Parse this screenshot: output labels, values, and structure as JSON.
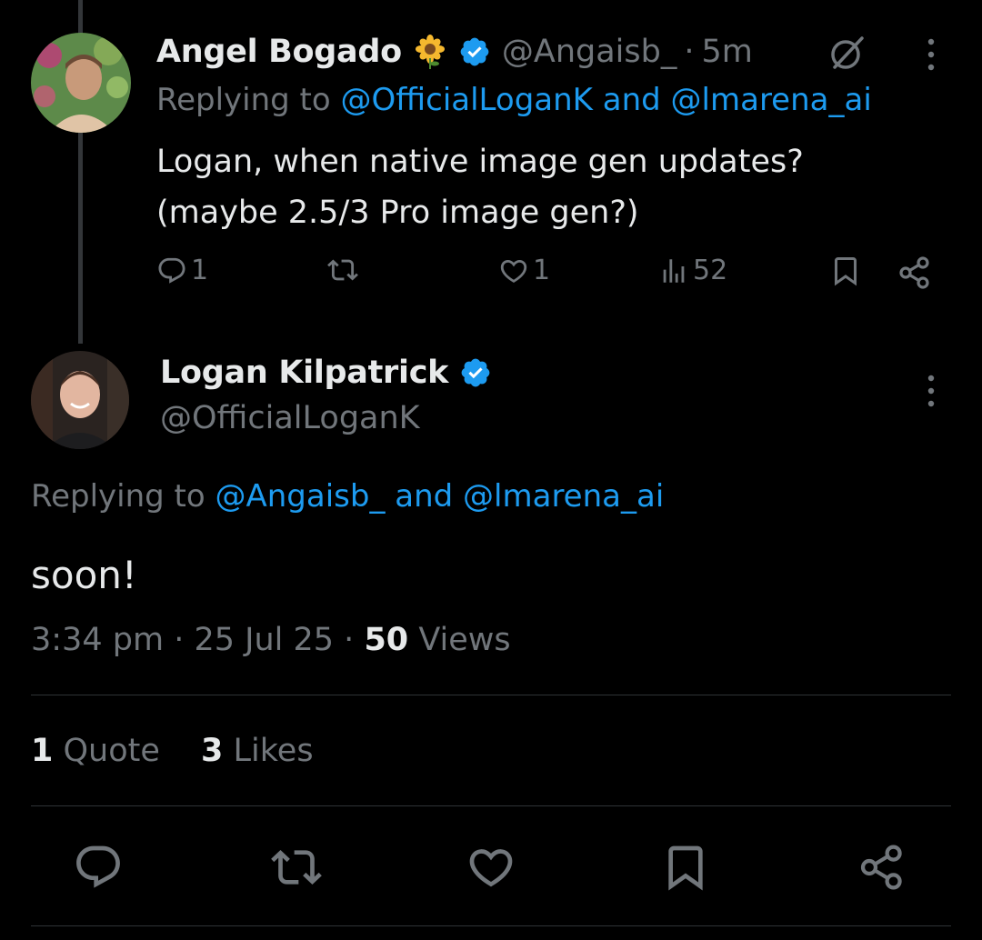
{
  "reply_tweet": {
    "display_name": "Angel Bogado",
    "emoji": "🌻",
    "handle": "@Angaisb_",
    "separator": "·",
    "time_ago": "5m",
    "replying_prefix": "Replying to ",
    "replying_users": "@OfficialLoganK and @lmarena_ai",
    "text_line1": "Logan, when native image gen updates?",
    "text_line2": "(maybe 2.5/3 Pro image gen?)",
    "actions": {
      "reply_count": "1",
      "repost_count": "",
      "like_count": "1",
      "views_count": "52"
    }
  },
  "main_tweet": {
    "display_name": "Logan Kilpatrick",
    "handle": "@OfficialLoganK",
    "replying_prefix": "Replying to ",
    "replying_users": "@Angaisb_ and @lmarena_ai",
    "text": "soon!",
    "time": "3:34 pm",
    "date": "25 Jul 25",
    "separator": "·",
    "views_count": "50",
    "views_label": "Views",
    "quotes_count": "1",
    "quotes_label": "Quote",
    "likes_count": "3",
    "likes_label": "Likes"
  },
  "icons": {
    "reply": "reply-icon",
    "repost": "repost-icon",
    "like": "heart-icon",
    "views": "views-icon",
    "bookmark": "bookmark-icon",
    "share": "share-icon",
    "more": "more-icon",
    "grok": "grok-icon",
    "verified": "verified-badge-icon"
  },
  "colors": {
    "background": "#000000",
    "text_primary": "#e7e9ea",
    "text_secondary": "#71767b",
    "accent_link": "#1d9bf0",
    "divider": "#2f3336"
  }
}
